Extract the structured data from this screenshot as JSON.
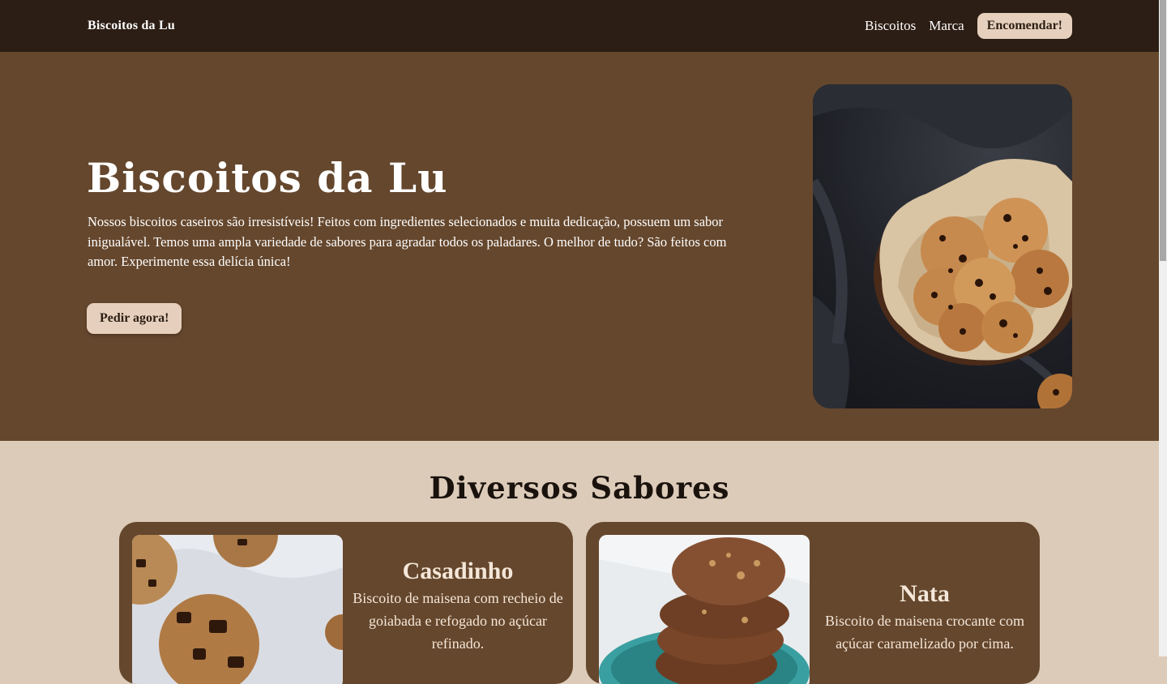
{
  "nav": {
    "brand": "Biscoitos da Lu",
    "links": [
      "Biscoitos",
      "Marca"
    ],
    "cta": "Encomendar!"
  },
  "hero": {
    "title": "Biscoitos da Lu",
    "text": "Nossos biscoitos caseiros são irresistíveis! Feitos com ingredientes selecionados e muita dedicação, possuem um sabor inigualável. Temos uma ampla variedade de sabores para agradar todos os paladares. O melhor de tudo? São feitos com amor. Experimente essa delícia única!",
    "button": "Pedir agora!",
    "image_icon": "cookie-basket-photo"
  },
  "flavors": {
    "title": "Diversos Sabores",
    "cards": [
      {
        "title": "Casadinho",
        "description": "Biscoito de maisena com recheio de goiabada e refogado no açúcar refinado.",
        "image_icon": "chocolate-chip-cookies-photo"
      },
      {
        "title": "Nata",
        "description": "Biscoito de maisena crocante com açúcar caramelizado por cima.",
        "image_icon": "stacked-cookies-photo"
      }
    ]
  },
  "colors": {
    "navbar": "#2c1e14",
    "hero_bg": "#65472d",
    "page_bg": "#dccbb9",
    "button_bg": "#e6d0bd"
  }
}
